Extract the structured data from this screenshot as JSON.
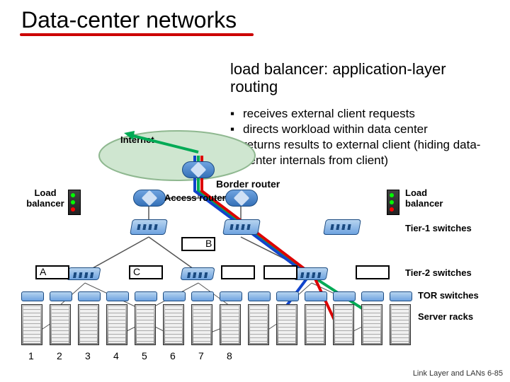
{
  "title": "Data-center networks",
  "subtitle": "load balancer: application-layer routing",
  "bullets": [
    "receives external client requests",
    "directs workload within data center",
    "returns results to external client (hiding data-center internals from client)"
  ],
  "labels": {
    "internet": "Internet",
    "border_router": "Border router",
    "access_router": "Access router",
    "load_balancer_left": "Load balancer",
    "load_balancer_right": "Load balancer",
    "tier1": "Tier-1 switches",
    "tier2": "Tier-2 switches",
    "tor": "TOR switches",
    "server_racks": "Server racks"
  },
  "switch_letters": {
    "a": "A",
    "b": "B",
    "c": "C"
  },
  "rack_numbers": [
    "1",
    "2",
    "3",
    "4",
    "5",
    "6",
    "7",
    "8"
  ],
  "footer": "Link Layer and LANs  6-85"
}
